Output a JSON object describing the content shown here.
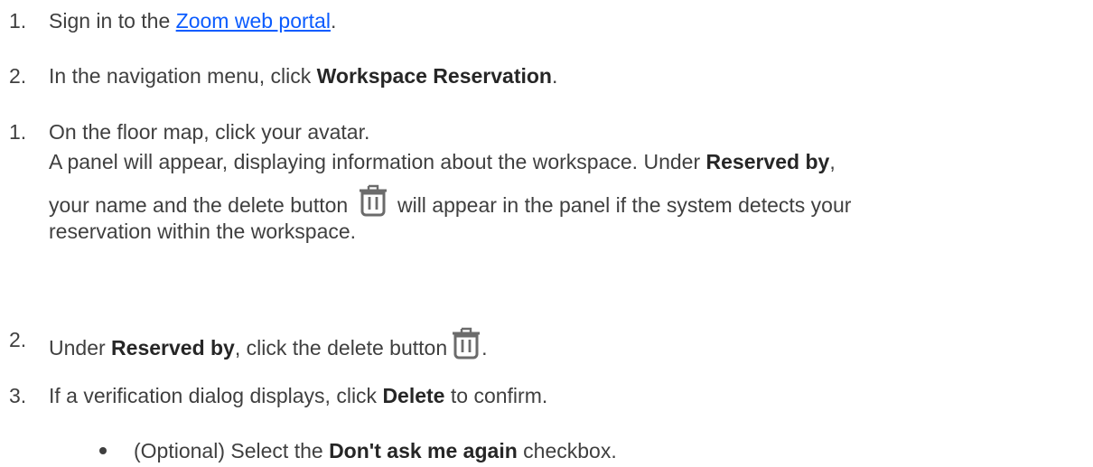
{
  "steps_group_1": [
    {
      "number": "1.",
      "text_before": "Sign in to the ",
      "link": "Zoom web portal",
      "text_after": "."
    },
    {
      "number": "2.",
      "text_before": "In the navigation menu, click ",
      "bold": "Workspace Reservation",
      "text_after": "."
    }
  ],
  "steps_group_2": {
    "step1": {
      "number": "1.",
      "line1": "On the floor map, click your avatar.",
      "line2_before": "A panel will appear, displaying information about the workspace. Under ",
      "line2_bold": "Reserved by",
      "line2_after": ",",
      "line3_before": "your name and the delete button",
      "line3_after": "will appear in the panel if the system detects your",
      "line4": "reservation within the workspace."
    },
    "step2": {
      "number": "2.",
      "text_before": "Under ",
      "bold": "Reserved by",
      "text_middle": ", click the delete button",
      "text_after": "."
    },
    "step3": {
      "number": "3.",
      "text_before": "If a verification dialog displays, click ",
      "bold": "Delete",
      "text_after": " to confirm."
    },
    "bullet": {
      "text_before": "(Optional) Select the ",
      "bold": "Don't ask me again",
      "text_after": " checkbox."
    }
  },
  "icons": {
    "delete": "trash-icon"
  },
  "colors": {
    "text": "#3f3f3f",
    "bold": "#262626",
    "link": "#0b5cff",
    "icon": "#6b6b6b"
  }
}
